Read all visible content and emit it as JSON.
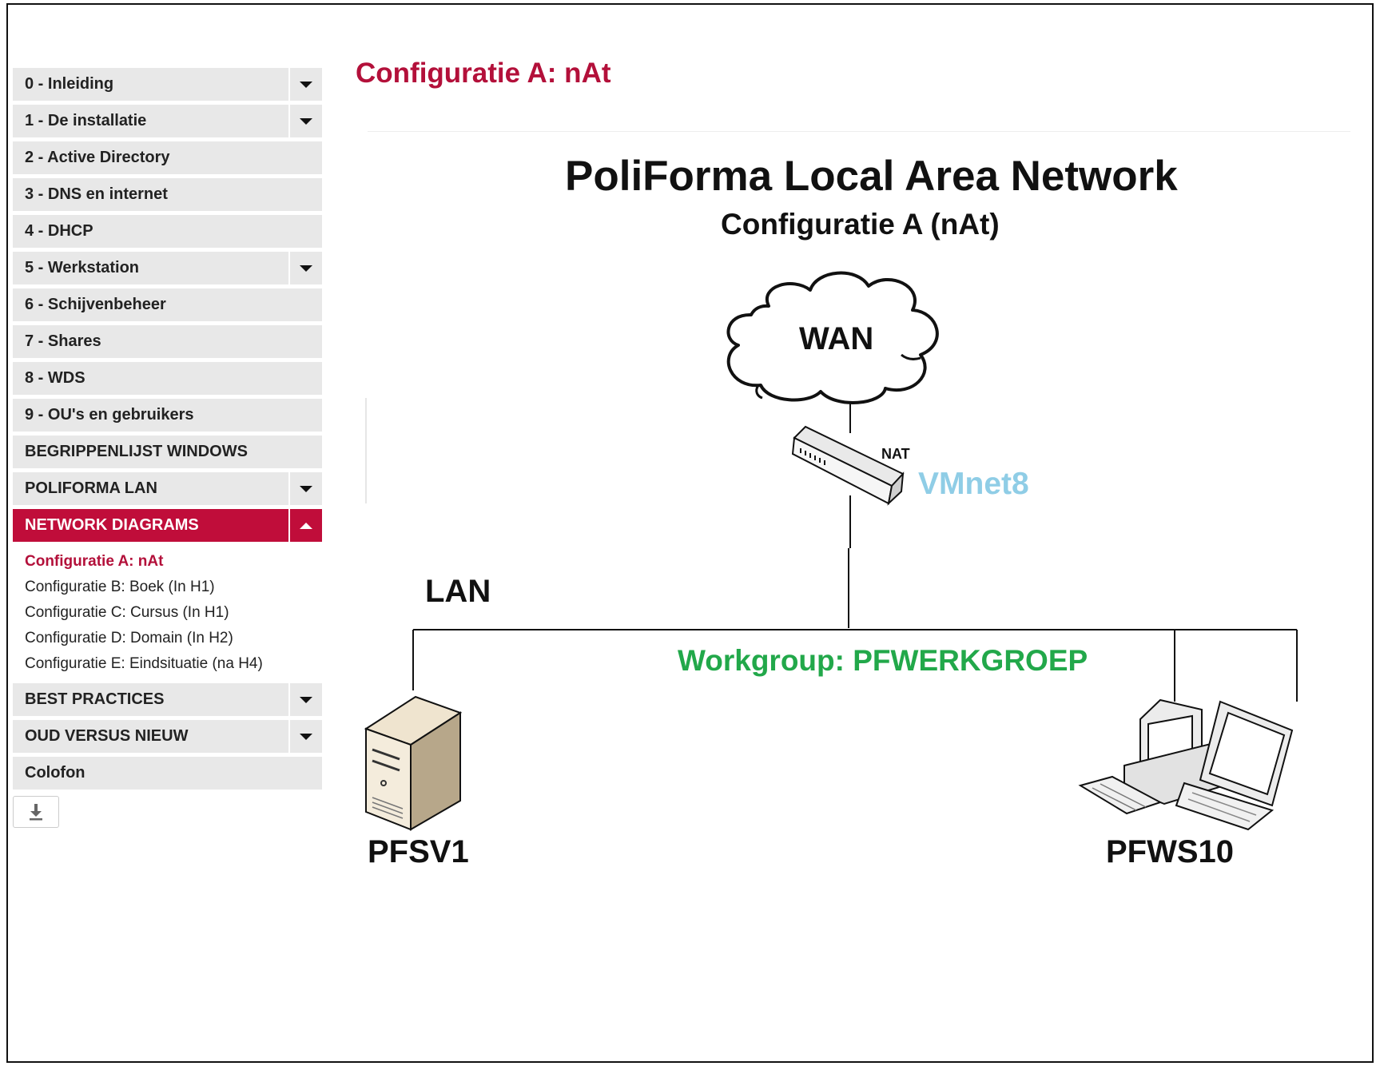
{
  "page": {
    "title": "Configuratie A: nAt"
  },
  "sidebar": {
    "items": [
      {
        "label": "0 - Inleiding",
        "expandable": true
      },
      {
        "label": "1 - De installatie",
        "expandable": true
      },
      {
        "label": "2 - Active Directory",
        "expandable": false
      },
      {
        "label": "3 - DNS en internet",
        "expandable": false
      },
      {
        "label": "4 - DHCP",
        "expandable": false
      },
      {
        "label": "5 - Werkstation",
        "expandable": true
      },
      {
        "label": "6 - Schijvenbeheer",
        "expandable": false
      },
      {
        "label": "7 - Shares",
        "expandable": false
      },
      {
        "label": "8 - WDS",
        "expandable": false
      },
      {
        "label": "9 - OU's en gebruikers",
        "expandable": false
      },
      {
        "label": "BEGRIPPENLIJST WINDOWS",
        "expandable": false
      },
      {
        "label": "POLIFORMA LAN",
        "expandable": true
      },
      {
        "label": "NETWORK DIAGRAMS",
        "expandable": true,
        "expanded": true,
        "active": true
      },
      {
        "label": "BEST PRACTICES",
        "expandable": true
      },
      {
        "label": "OUD VERSUS NIEUW",
        "expandable": true
      },
      {
        "label": "Colofon",
        "expandable": false
      }
    ],
    "subitems": [
      {
        "label": "Configuratie A: nAt",
        "current": true
      },
      {
        "label": "Configuratie B: Boek (In H1)"
      },
      {
        "label": "Configuratie C: Cursus (In H1)"
      },
      {
        "label": "Configuratie D: Domain (In H2)"
      },
      {
        "label": "Configuratie E: Eindsituatie (na H4)"
      }
    ],
    "download_icon": "download-icon"
  },
  "diagram": {
    "title": "PoliForma Local Area Network",
    "subtitle": "Configuratie A (nAt)",
    "wan_label": "WAN",
    "nat_label": "NAT",
    "vmnet_label": "VMnet8",
    "lan_label": "LAN",
    "workgroup_label": "Workgroup: PFWERKGROEP",
    "server_label": "PFSV1",
    "workstation_label": "PFWS10",
    "colors": {
      "accent": "#c00d3a",
      "vmnet": "#8fcde6",
      "workgroup": "#22a84a"
    }
  }
}
